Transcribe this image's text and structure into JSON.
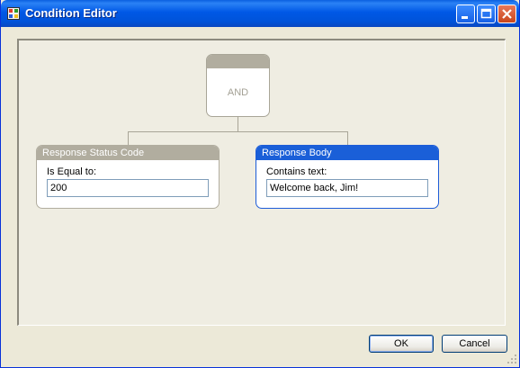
{
  "window": {
    "title": "Condition Editor",
    "icon": "app-icon"
  },
  "title_buttons": [
    "minimize-icon",
    "maximize-icon",
    "close-icon"
  ],
  "tree": {
    "root": {
      "label": "AND"
    },
    "conditions": [
      {
        "header": "Response Status Code",
        "field_label": "Is Equal to:",
        "value": "200",
        "selected": false
      },
      {
        "header": "Response Body",
        "field_label": "Contains text:",
        "value": "Welcome back, Jim!",
        "selected": true
      }
    ]
  },
  "footer": {
    "ok_label": "OK",
    "cancel_label": "Cancel"
  },
  "colors": {
    "titlebar": "#0058e6",
    "node_header": "#b1ad9f",
    "selected_header": "#1a5fd8",
    "dialog_bg": "#ece9d8"
  }
}
